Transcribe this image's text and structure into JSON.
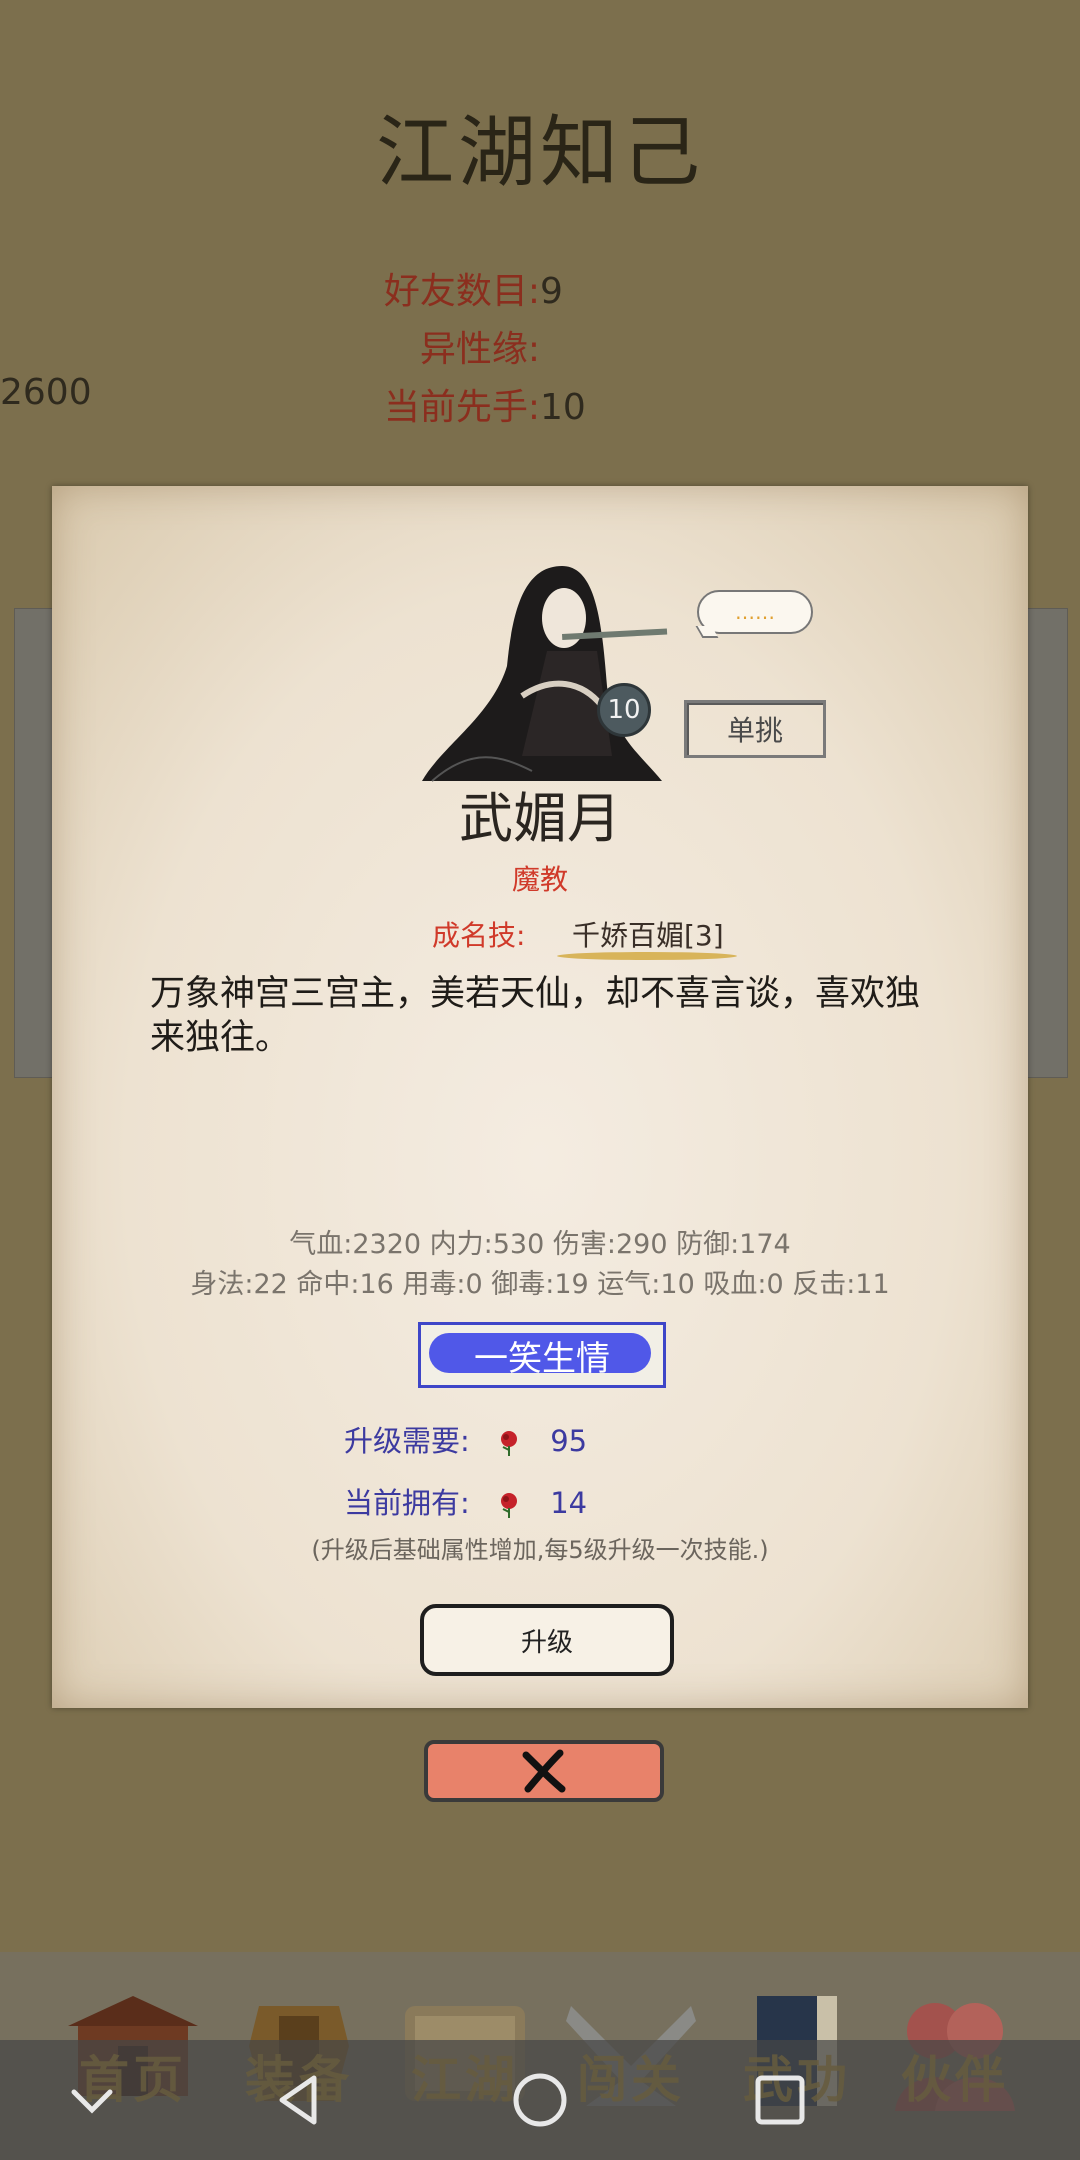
{
  "page": {
    "title": "江湖知己"
  },
  "stats": [
    {
      "label": "好友数目:",
      "value": "9"
    },
    {
      "label": "异性缘:",
      "value": "2600"
    },
    {
      "label": "当前先手:",
      "value": "10"
    }
  ],
  "card": {
    "speech": "……",
    "level": "10",
    "duel_label": "单挑",
    "name": "武媚月",
    "sect": "魔教",
    "skill_label": "成名技:",
    "skill_name": "千娇百媚[3]",
    "description": "万象神宫三宫主，美若天仙，却不喜言谈，喜欢独来独往。",
    "attrs_line1": "气血:2320  内力:530  伤害:290  防御:174",
    "attrs_line2": "身法:22  命中:16  用毒:0  御毒:19  运气:10  吸血:0  反击:11",
    "title_badge": "一笑生情",
    "upgrade_need_label": "升级需要:",
    "upgrade_need_value": "95",
    "owned_label": "当前拥有:",
    "owned_value": "14",
    "note": "(升级后基础属性增加,每5级升级一次技能.)",
    "upgrade_button": "升级",
    "rose_icon": "rose-icon"
  },
  "close_icon": "close-x-icon",
  "tabs": [
    {
      "label": "首页",
      "icon": "home-icon"
    },
    {
      "label": "装备",
      "icon": "armor-icon"
    },
    {
      "label": "江湖",
      "icon": "scroll-icon"
    },
    {
      "label": "闯关",
      "icon": "swords-icon"
    },
    {
      "label": "武功",
      "icon": "book-icon"
    },
    {
      "label": "伙伴",
      "icon": "partners-icon"
    }
  ],
  "navbar": {
    "icons": [
      "nav-collapse-icon",
      "nav-back-icon",
      "nav-home-icon",
      "nav-recent-icon"
    ]
  },
  "colors": {
    "background": "#7c6f4d",
    "accent_red": "#d03a2a",
    "accent_blue": "#3c3aa0",
    "close": "#e8826a"
  }
}
